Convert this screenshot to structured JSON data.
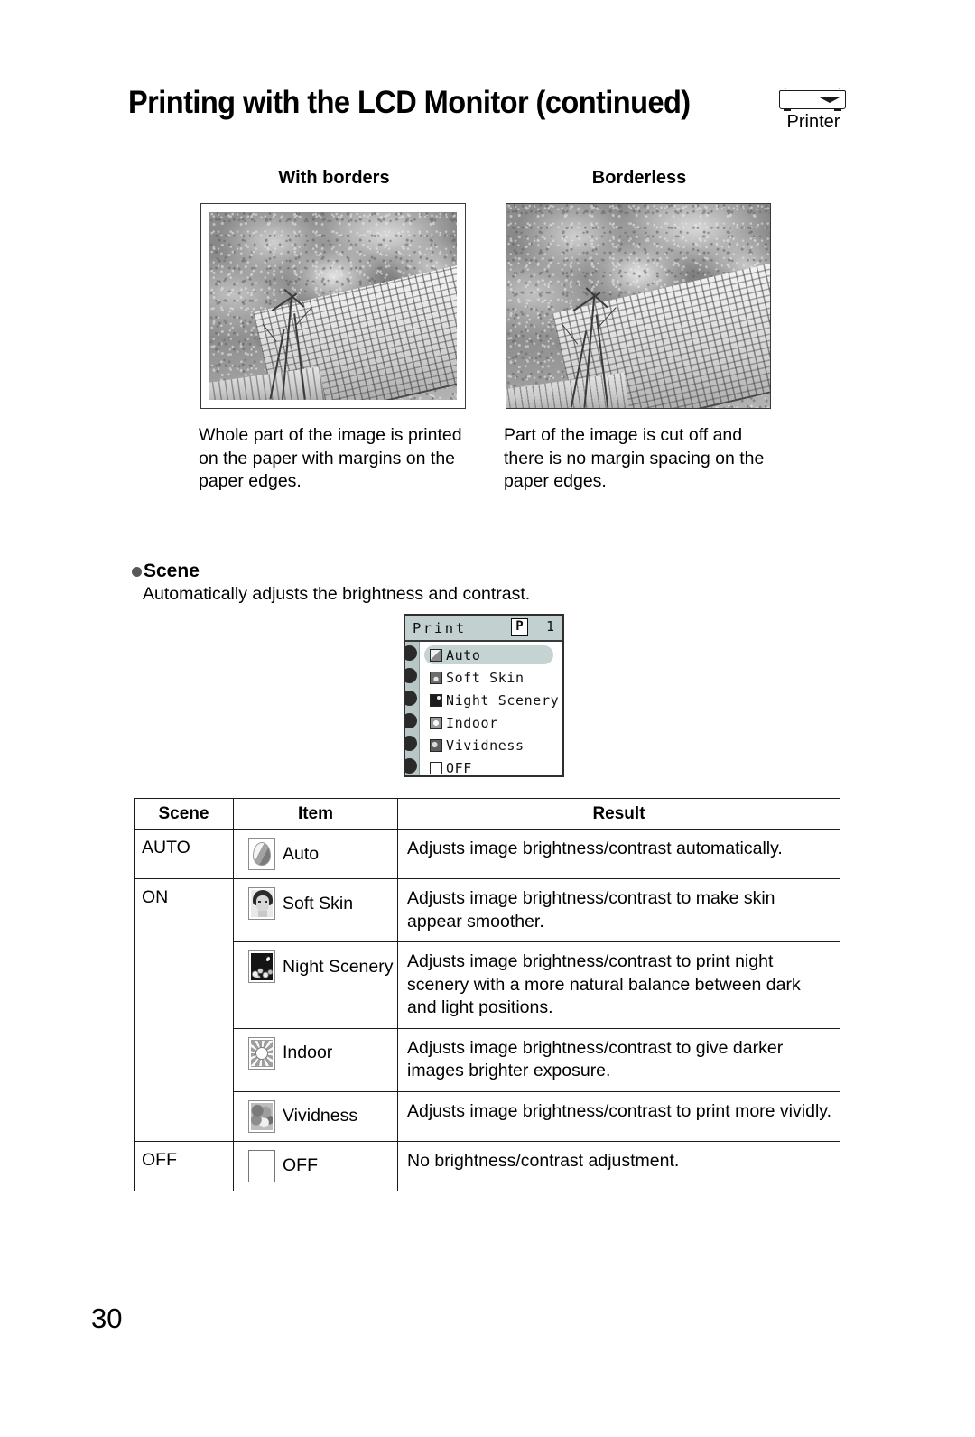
{
  "document": {
    "title": "Printing with the LCD Monitor (continued)",
    "page_number": "30",
    "device_tag": {
      "icon": "printer-icon",
      "label": "Printer"
    }
  },
  "comparison": {
    "columns": [
      {
        "label": "With borders",
        "caption": "Whole part of the image is printed on the paper with margins on the paper edges.",
        "photo_alt": "temple-roof-and-trees-photo-with-white-margin"
      },
      {
        "label": "Borderless",
        "caption": "Part of the image is cut off and there is no margin spacing on the paper edges.",
        "photo_alt": "temple-roof-and-trees-photo-full-bleed"
      }
    ]
  },
  "scene_section": {
    "heading": "Scene",
    "description": "Automatically adjusts the brightness and contrast."
  },
  "lcd": {
    "title": "Print",
    "badge": "P",
    "count": "1",
    "items": [
      {
        "label": "Auto",
        "icon": "scene-auto-icon",
        "selected": true
      },
      {
        "label": "Soft Skin",
        "icon": "scene-skin-icon",
        "selected": false
      },
      {
        "label": "Night Scenery",
        "icon": "scene-night-icon",
        "selected": false
      },
      {
        "label": "Indoor",
        "icon": "scene-indoor-icon",
        "selected": false
      },
      {
        "label": "Vividness",
        "icon": "scene-vivid-icon",
        "selected": false
      },
      {
        "label": "OFF",
        "icon": "scene-off-icon",
        "selected": false
      }
    ]
  },
  "table": {
    "headers": {
      "scene": "Scene",
      "item": "Item",
      "result": "Result"
    },
    "groups": [
      {
        "scene": "AUTO",
        "rows": [
          {
            "item": "Auto",
            "icon": "scene-auto-icon",
            "result": "Adjusts image brightness/contrast automatically."
          }
        ]
      },
      {
        "scene": "ON",
        "rows": [
          {
            "item": "Soft Skin",
            "icon": "scene-skin-icon",
            "result": "Adjusts image brightness/contrast to make skin appear smoother."
          },
          {
            "item": "Night Scenery",
            "icon": "scene-night-icon",
            "result": "Adjusts image brightness/contrast to print night scenery with a more natural balance between dark and light positions."
          },
          {
            "item": "Indoor",
            "icon": "scene-indoor-icon",
            "result": "Adjusts image brightness/contrast to give darker images brighter exposure."
          },
          {
            "item": "Vividness",
            "icon": "scene-vivid-icon",
            "result": "Adjusts image brightness/contrast to print more vividly."
          }
        ]
      },
      {
        "scene": "OFF",
        "rows": [
          {
            "item": "OFF",
            "icon": "scene-off-icon",
            "result": "No brightness/contrast adjustment."
          }
        ]
      }
    ]
  },
  "colors": {
    "text": "#000000",
    "rule": "#1a1a1a",
    "lcd_titlebar": "#c2d0d0",
    "lcd_highlight": "#c6d3d3",
    "lcd_rail": "#b9c6c6",
    "bullet": "#585858"
  }
}
